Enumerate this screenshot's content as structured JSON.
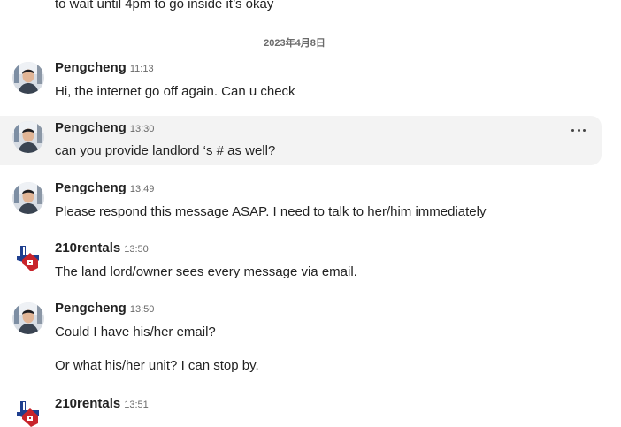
{
  "thread": {
    "cut_off_text": "to wait until 4pm to go inside it’s okay",
    "date_separator": "2023年4月8日",
    "messages": [
      {
        "sender": "Pengcheng",
        "time": "11:13",
        "text": "Hi, the internet go off again. Can u check",
        "avatar": "person-photo"
      },
      {
        "sender": "Pengcheng",
        "time": "13:30",
        "text": "can you provide landlord ‘s # as well?",
        "avatar": "person-photo",
        "hovered": true
      },
      {
        "sender": "Pengcheng",
        "time": "13:49",
        "text": "Please respond this message ASAP. I need to talk to her/him immediately",
        "avatar": "person-photo"
      },
      {
        "sender": "210rentals",
        "time": "13:50",
        "text": "The land lord/owner sees every message via email.",
        "avatar": "texas-house-logo"
      },
      {
        "sender": "Pengcheng",
        "time": "13:50",
        "text": "Could I have his/her email?",
        "avatar": "person-photo"
      },
      {
        "sender": "210rentals",
        "time": "13:51",
        "text": "",
        "avatar": "texas-house-logo"
      }
    ],
    "followup_text": "Or what his/her unit? I can stop by.",
    "more_actions_icon": "more-horizontal-icon"
  }
}
